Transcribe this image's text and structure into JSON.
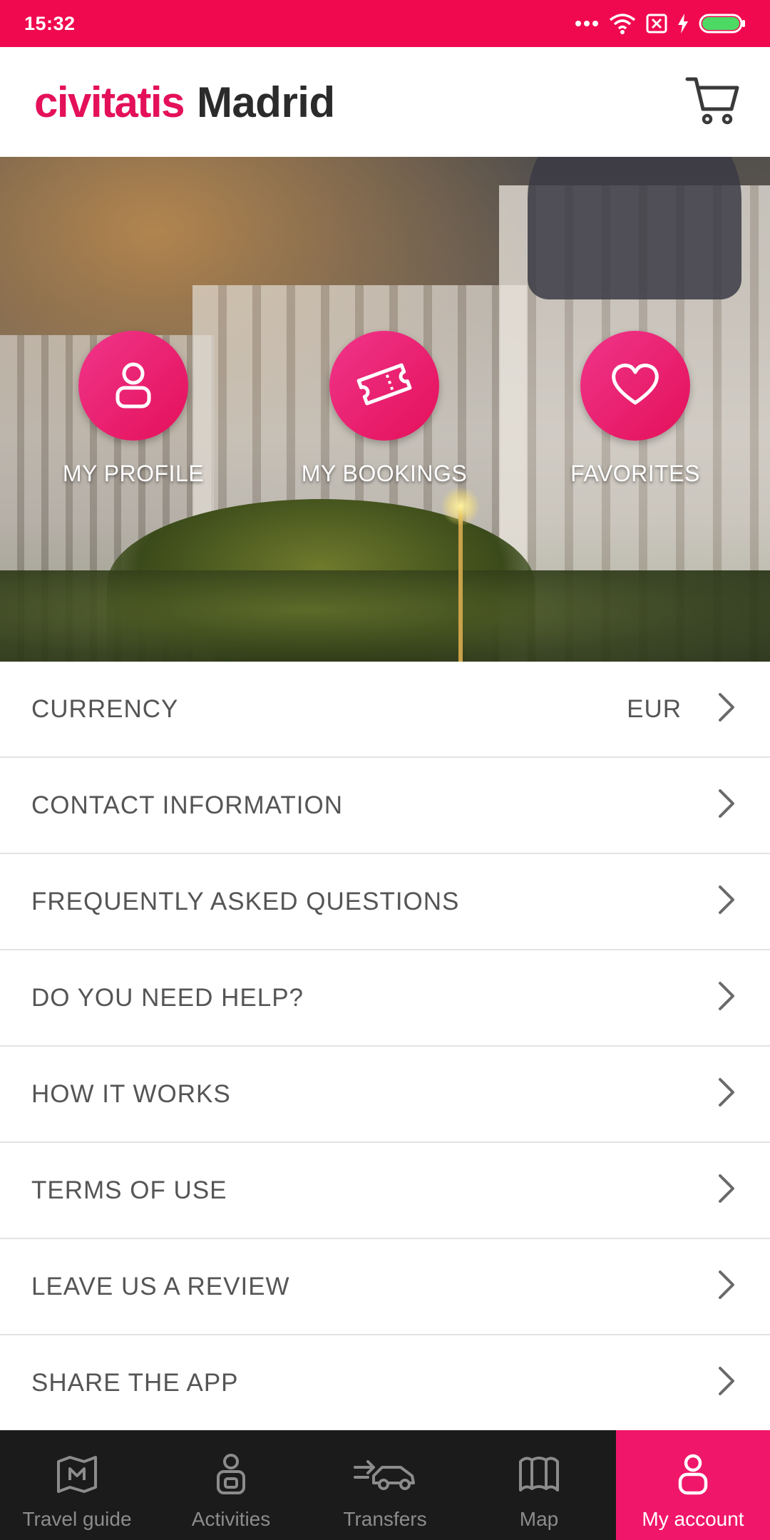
{
  "status_bar": {
    "time": "15:32"
  },
  "header": {
    "brand": "civitatis",
    "city": "Madrid",
    "cart_icon": "cart-icon"
  },
  "hero": {
    "actions": [
      {
        "label": "MY PROFILE",
        "icon": "user-icon"
      },
      {
        "label": "MY BOOKINGS",
        "icon": "ticket-icon"
      },
      {
        "label": "FAVORITES",
        "icon": "heart-icon"
      }
    ]
  },
  "menu": {
    "items": [
      {
        "label": "CURRENCY",
        "value": "EUR"
      },
      {
        "label": "CONTACT INFORMATION"
      },
      {
        "label": "FREQUENTLY ASKED QUESTIONS"
      },
      {
        "label": "DO YOU NEED HELP?"
      },
      {
        "label": "HOW IT WORKS"
      },
      {
        "label": "TERMS OF USE"
      },
      {
        "label": "LEAVE US A REVIEW"
      },
      {
        "label": "SHARE THE APP"
      }
    ]
  },
  "bottom_nav": {
    "items": [
      {
        "label": "Travel guide",
        "icon": "map-pin-icon"
      },
      {
        "label": "Activities",
        "icon": "activities-icon"
      },
      {
        "label": "Transfers",
        "icon": "transfer-car-icon"
      },
      {
        "label": "Map",
        "icon": "map-icon"
      },
      {
        "label": "My account",
        "icon": "account-icon",
        "active": true
      }
    ]
  },
  "colors": {
    "brand_pink": "#e4105a",
    "status_bar": "#f0094f",
    "nav_background": "#1b1b1b",
    "nav_active": "#f0176a"
  }
}
